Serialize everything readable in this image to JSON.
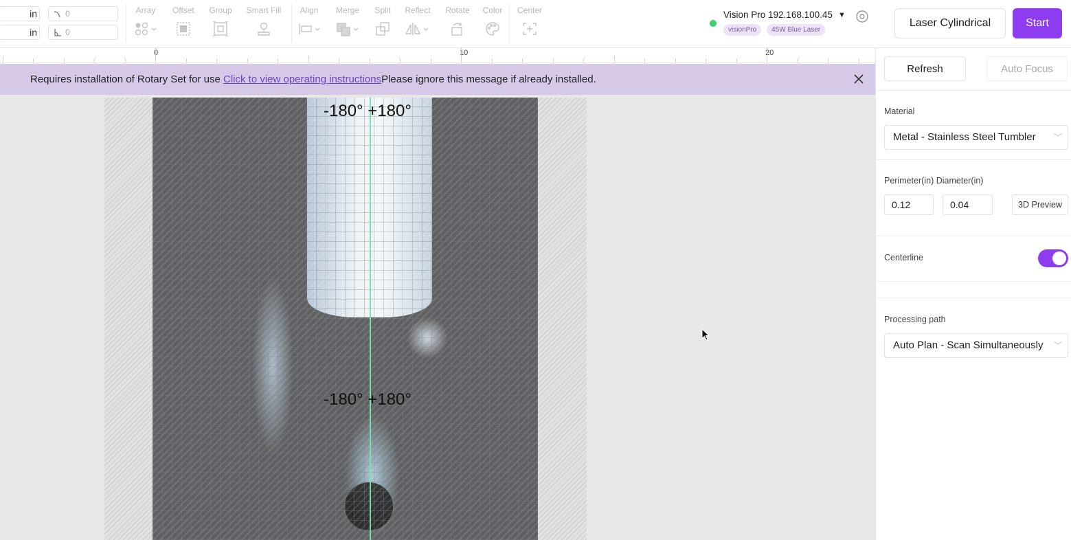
{
  "toolbar": {
    "unit1": "in",
    "unit2": "in",
    "corner_value": "0",
    "angle_value": "0",
    "tools": [
      {
        "label": "Array",
        "icon": "array-icon"
      },
      {
        "label": "Offset",
        "icon": "offset-icon"
      },
      {
        "label": "Group",
        "icon": "group-icon"
      },
      {
        "label": "Smart Fill",
        "icon": "smart-fill-icon"
      },
      {
        "label": "Align",
        "icon": "align-icon"
      },
      {
        "label": "Merge",
        "icon": "merge-icon"
      },
      {
        "label": "Split",
        "icon": "split-icon"
      },
      {
        "label": "Reflect",
        "icon": "reflect-icon"
      },
      {
        "label": "Rotate",
        "icon": "rotate-icon"
      },
      {
        "label": "Color",
        "icon": "palette-icon"
      },
      {
        "label": "Center",
        "icon": "center-icon"
      }
    ],
    "device_name": "Vision Pro 192.168.100.45",
    "device_badges": [
      "visionPro",
      "45W Blue Laser"
    ],
    "laser_mode_button": "Laser Cylindrical",
    "start_button": "Start"
  },
  "ruler": {
    "labels": [
      "0",
      "10",
      "20"
    ]
  },
  "notice": {
    "text_before": "Requires installation of Rotary Set for use ",
    "link_text": "Click to view operating instructions",
    "text_after": "Please ignore this message if already installed."
  },
  "canvas": {
    "top_label": "-180° +180°",
    "middle_label": "-180° +180°"
  },
  "panel": {
    "refresh_button": "Refresh",
    "auto_focus_button": "Auto Focus",
    "material_label": "Material",
    "material_value": "Metal - Stainless Steel Tumbler",
    "perimeter_diameter_label": "Perimeter(in) Diameter(in)",
    "perimeter_value": "0.12",
    "diameter_value": "0.04",
    "preview_button": "3D Preview",
    "centerline_label": "Centerline",
    "centerline_on": true,
    "processing_label": "Processing path",
    "processing_value": "Auto Plan - Scan Simultaneously"
  },
  "colors": {
    "accent": "#8e3cf0",
    "notice_bg": "#d6c9e8",
    "status_online": "#3ed36b",
    "centerline": "#7ee0a6"
  }
}
